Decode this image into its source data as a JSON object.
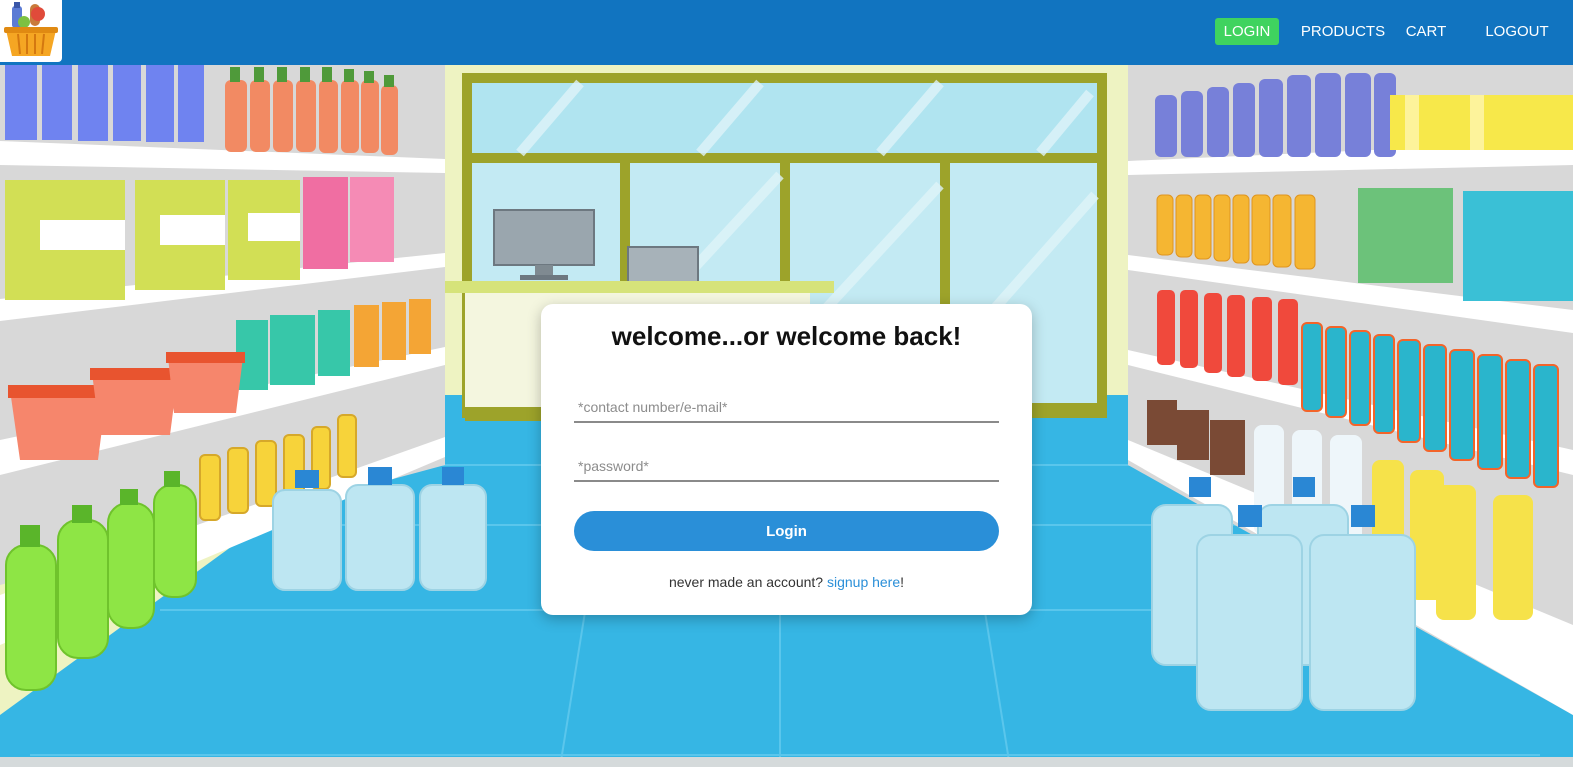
{
  "nav": {
    "logo_icon": "grocery-basket-icon",
    "links": [
      "LOGIN",
      "PRODUCTS",
      "CART",
      "LOGOUT"
    ],
    "active": "LOGIN"
  },
  "login_form": {
    "title": "welcome...or welcome back!",
    "contact_placeholder": "*contact number/e-mail*",
    "password_placeholder": "*password*",
    "submit_label": "Login",
    "signup_prompt": "never made an account?",
    "signup_link": "signup here",
    "signup_suffix": "!"
  },
  "colors": {
    "navbar": "#1174c0",
    "active_nav": "#3fd35f",
    "button": "#2a8fd8",
    "floor": "#36b6e4"
  }
}
